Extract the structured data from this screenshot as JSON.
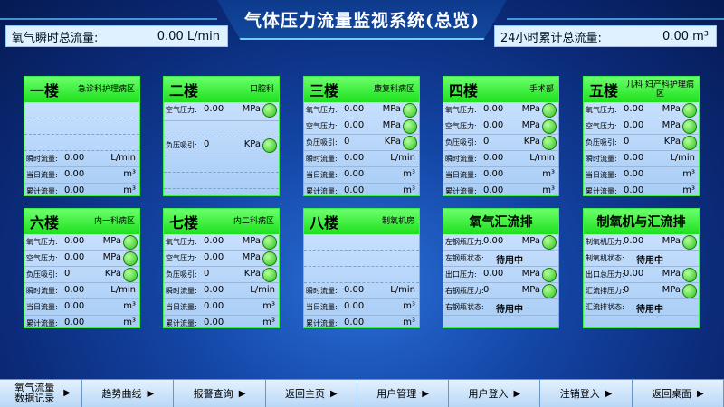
{
  "header": {
    "title": "气体压力流量监视系统(总览)"
  },
  "flow_instant": {
    "label": "氧气瞬时总流量:",
    "value": "0.00  L/min"
  },
  "flow_total": {
    "label": "24小时累计总流量:",
    "value": "0.00 m³"
  },
  "panels": [
    {
      "floor": "一楼",
      "dept": "急诊科护理病区",
      "rows": [
        {
          "k": "",
          "v": ""
        },
        {
          "k": "",
          "v": ""
        },
        {
          "k": "",
          "v": ""
        },
        {
          "k": "瞬时流量:",
          "v": "0.00",
          "u": "L/min"
        },
        {
          "k": "当日流量:",
          "v": "0.00",
          "u": "m³"
        },
        {
          "k": "累计流量:",
          "v": "0.00",
          "u": "m³"
        }
      ]
    },
    {
      "floor": "二楼",
      "dept": "口腔科",
      "rows": [
        {
          "k": "空气压力:",
          "v": "0.00",
          "u": "MPa"
        },
        {
          "k": "负压吸引:",
          "v": "0",
          "u": "KPa"
        }
      ]
    },
    {
      "floor": "三楼",
      "dept": "康复科病区",
      "rows": [
        {
          "k": "氧气压力:",
          "v": "0.00",
          "u": "MPa"
        },
        {
          "k": "空气压力:",
          "v": "0.00",
          "u": "MPa"
        },
        {
          "k": "负压吸引:",
          "v": "0",
          "u": "KPa"
        },
        {
          "k": "瞬时流量:",
          "v": "0.00",
          "u": "L/min"
        },
        {
          "k": "当日流量:",
          "v": "0.00",
          "u": "m³"
        },
        {
          "k": "累计流量:",
          "v": "0.00",
          "u": "m³"
        }
      ]
    },
    {
      "floor": "四楼",
      "dept": "手术部",
      "rows": [
        {
          "k": "氧气压力:",
          "v": "0.00",
          "u": "MPa"
        },
        {
          "k": "空气压力:",
          "v": "0.00",
          "u": "MPa"
        },
        {
          "k": "负压吸引:",
          "v": "0",
          "u": "KPa"
        },
        {
          "k": "瞬时流量:",
          "v": "0.00",
          "u": "L/min"
        },
        {
          "k": "当日流量:",
          "v": "0.00",
          "u": "m³"
        },
        {
          "k": "累计流量:",
          "v": "0.00",
          "u": "m³"
        }
      ]
    },
    {
      "floor": "五楼",
      "dept": "儿科 妇产科护理病区",
      "rows": [
        {
          "k": "氧气压力:",
          "v": "0.00",
          "u": "MPa"
        },
        {
          "k": "空气压力:",
          "v": "0.00",
          "u": "MPa"
        },
        {
          "k": "负压吸引:",
          "v": "0",
          "u": "KPa"
        },
        {
          "k": "瞬时流量:",
          "v": "0.00",
          "u": "L/min"
        },
        {
          "k": "当日流量:",
          "v": "0.00",
          "u": "m³"
        },
        {
          "k": "累计流量:",
          "v": "0.00",
          "u": "m³"
        }
      ]
    },
    {
      "floor": "六楼",
      "dept": "内一科病区",
      "rows": [
        {
          "k": "氧气压力:",
          "v": "0.00",
          "u": "MPa"
        },
        {
          "k": "空气压力:",
          "v": "0.00",
          "u": "MPa"
        },
        {
          "k": "负压吸引:",
          "v": "0",
          "u": "KPa"
        },
        {
          "k": "瞬时流量:",
          "v": "0.00",
          "u": "L/min"
        },
        {
          "k": "当日流量:",
          "v": "0.00",
          "u": "m³"
        },
        {
          "k": "累计流量:",
          "v": "0.00",
          "u": "m³"
        }
      ]
    },
    {
      "floor": "七楼",
      "dept": "内二科病区",
      "rows": [
        {
          "k": "氧气压力:",
          "v": "0.00",
          "u": "MPa"
        },
        {
          "k": "空气压力:",
          "v": "0.00",
          "u": "MPa"
        },
        {
          "k": "负压吸引:",
          "v": "0",
          "u": "KPa"
        },
        {
          "k": "瞬时流量:",
          "v": "0.00",
          "u": "L/min"
        },
        {
          "k": "当日流量:",
          "v": "0.00",
          "u": "m³"
        },
        {
          "k": "累计流量:",
          "v": "0.00",
          "u": "m³"
        }
      ]
    },
    {
      "floor": "八楼",
      "dept": "制氧机房",
      "rows": [
        {
          "k": "瞬时流量:",
          "v": "0.00",
          "u": "L/min"
        },
        {
          "k": "当日流量:",
          "v": "0.00",
          "u": "m³"
        },
        {
          "k": "累计流量:",
          "v": "0.00",
          "u": "m³"
        }
      ]
    },
    {
      "title": "氧气汇流排",
      "rows": [
        {
          "k": "左钢瓶压力:",
          "v": "0.00",
          "u": "MPa"
        },
        {
          "k": "左钢瓶状态:",
          "status": "待用中"
        },
        {
          "k": "出口压力:",
          "v": "0.00",
          "u": "MPa"
        },
        {
          "k": "右钢瓶压力:",
          "v": "0",
          "u": "MPa"
        },
        {
          "k": "右钢瓶状态:",
          "status": "待用中"
        }
      ]
    },
    {
      "title": "制氧机与汇流排",
      "rows": [
        {
          "k": "制氧机压力:",
          "v": "0.00",
          "u": "MPa"
        },
        {
          "k": "制氧机状态:",
          "status": "待用中"
        },
        {
          "k": "出口总压力:",
          "v": "0.00",
          "u": "MPa"
        },
        {
          "k": "汇流排压力:",
          "v": "0",
          "u": "MPa"
        },
        {
          "k": "汇流排状态:",
          "status": "待用中"
        }
      ]
    }
  ],
  "nav": [
    "氧气流量 数据记录",
    "趋势曲线",
    "报警查询",
    "返回主页",
    "用户管理",
    "用户登入",
    "注销登入",
    "返回桌面"
  ],
  "icons": {
    "arrow": "play-arrow-icon",
    "indicator": "green-status-dot-icon"
  },
  "colors": {
    "panel_header": "#1ee01e",
    "status_dot": "#27c21b",
    "background": "#1447a8"
  }
}
